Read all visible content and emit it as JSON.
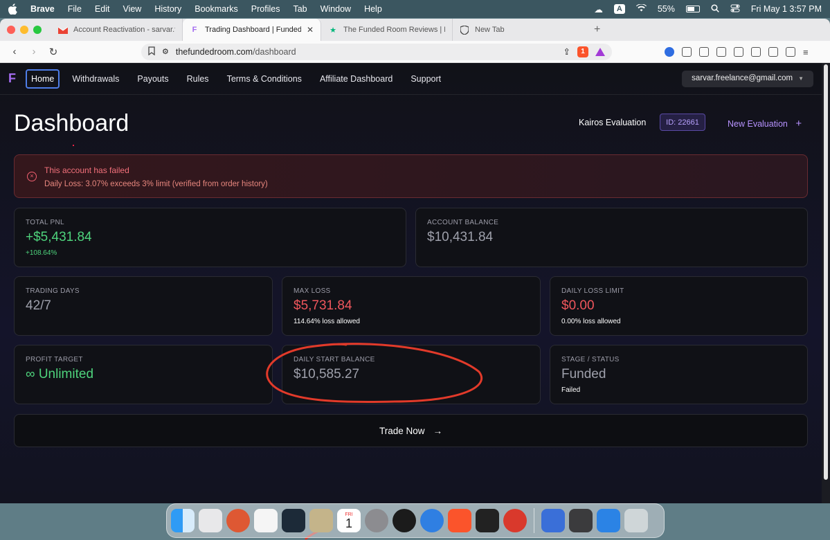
{
  "menubar": {
    "app": "Brave",
    "items": [
      "File",
      "Edit",
      "View",
      "History",
      "Bookmarks",
      "Profiles",
      "Tab",
      "Window",
      "Help"
    ],
    "input_source": "A",
    "battery": "55%",
    "clock": "Fri May 1  3:57 PM"
  },
  "browser": {
    "tabs": [
      {
        "title": "Account Reactivation - sarvar.freel",
        "favicon": "gmail-icon"
      },
      {
        "title": "Trading Dashboard | Funded R",
        "favicon": "funded-room-icon",
        "active": true
      },
      {
        "title": "The Funded Room Reviews | Read",
        "favicon": "trustpilot-icon"
      },
      {
        "title": "New Tab",
        "favicon": "brave-shield-icon"
      }
    ],
    "url_domain": "thefundedroom.com",
    "url_path": "/dashboard",
    "shield_count": "1"
  },
  "nav": {
    "logo": "F",
    "links": [
      "Home",
      "Withdrawals",
      "Payouts",
      "Rules",
      "Terms & Conditions",
      "Affiliate Dashboard",
      "Support"
    ],
    "user_email": "sarvar.freelance@gmail.com",
    "user_caret": "▼"
  },
  "header": {
    "title": "Dashboard",
    "evaluation_name": "Kairos Evaluation",
    "evaluation_id": "ID: 22661",
    "new_evaluation": "New Evaluation",
    "new_evaluation_icon": "+"
  },
  "alert": {
    "title": "This account has failed",
    "message": "Daily Loss: 3.07% exceeds 3% limit (verified from order history)",
    "icon": "×"
  },
  "stats": {
    "total_pnl": {
      "label": "TOTAL PNL",
      "value": "+$5,431.84",
      "sub": "+108.64%"
    },
    "account_balance": {
      "label": "ACCOUNT BALANCE",
      "value": "$10,431.84"
    },
    "trading_days": {
      "label": "TRADING DAYS",
      "value": "42/7"
    },
    "max_loss": {
      "label": "MAX LOSS",
      "value": "$5,731.84",
      "sub": "114.64% loss allowed"
    },
    "daily_loss_limit": {
      "label": "DAILY LOSS LIMIT",
      "value": "$0.00",
      "sub": "0.00% loss allowed"
    },
    "profit_target": {
      "label": "PROFIT TARGET",
      "value": "∞ Unlimited"
    },
    "daily_start_balance": {
      "label": "DAILY START BALANCE",
      "value": "$10,585.27"
    },
    "stage_status": {
      "label": "STAGE / STATUS",
      "value": "Funded",
      "sub": "Failed"
    }
  },
  "trade": {
    "label": "Trade Now",
    "arrow": "→"
  },
  "colors": {
    "accent_purple": "#a46cf0",
    "positive_green": "#4ed37c",
    "negative_red": "#f0565c",
    "annotation_red": "#e23a2a"
  },
  "dock_calendar": {
    "month": "FRI",
    "day": "1"
  }
}
